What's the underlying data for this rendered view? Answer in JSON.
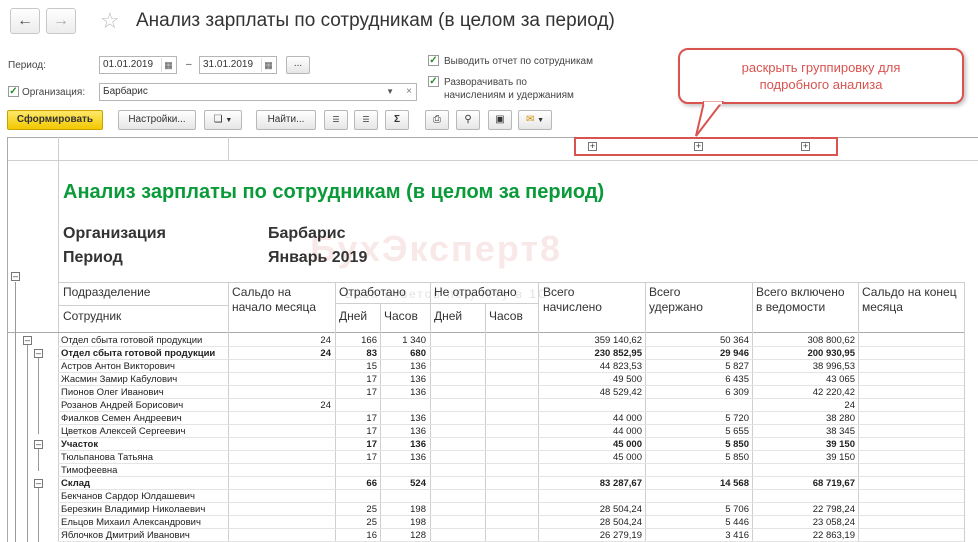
{
  "window": {
    "title": "Анализ зарплаты по сотрудникам (в целом за период)"
  },
  "form": {
    "period_label": "Период:",
    "date_from": "01.01.2019",
    "dash": "–",
    "date_to": "31.01.2019",
    "dots": "...",
    "org_label": "Организация:",
    "org_value": "Барбарис",
    "opt1": "Выводить отчет по сотрудникам",
    "opt2_line1": "Разворачивать по",
    "opt2_line2": "начислениям и удержаниям"
  },
  "toolbar": {
    "generate": "Сформировать",
    "settings": "Настройки...",
    "find": "Найти...",
    "sum": "Σ"
  },
  "callout": {
    "line1": "раскрыть группировку для",
    "line2": "подробного анализа"
  },
  "report": {
    "title": "Анализ зарплаты по сотрудникам (в целом за период)",
    "org_caption": "Организация",
    "org_value": "Барбарис",
    "period_caption": "Период",
    "period_value": "Январь 2019",
    "watermark": "БухЭксперт8",
    "watermark_sub": "База ответов по учёту в 1С"
  },
  "columns": {
    "dept": "Подразделение",
    "emp": "Сотрудник",
    "saldo_start": "Сальдо на начало месяца",
    "worked": "Отработано",
    "not_worked": "Не отработано",
    "days": "Дней",
    "hours": "Часов",
    "accrued": "Всего начислено",
    "withheld": "Всего удержано",
    "in_statement": "Всего включено в ведомости",
    "saldo_end": "Сальдо на конец месяца"
  },
  "rows": [
    {
      "name": "Отдел сбыта готовой продукции",
      "saldo": "24",
      "days": "166",
      "hours": "1 340",
      "accrued": "359 140,62",
      "withheld": "50 364",
      "statement": "308 800,62",
      "bold": false,
      "level": 0
    },
    {
      "name": "Отдел сбыта готовой продукции",
      "saldo": "24",
      "days": "83",
      "hours": "680",
      "accrued": "230 852,95",
      "withheld": "29 946",
      "statement": "200 930,95",
      "bold": true,
      "level": 1
    },
    {
      "name": "Астров Антон Викторович",
      "saldo": "",
      "days": "15",
      "hours": "136",
      "accrued": "44 823,53",
      "withheld": "5 827",
      "statement": "38 996,53",
      "bold": false,
      "level": 2
    },
    {
      "name": "Жасмин Замир Кабулович",
      "saldo": "",
      "days": "17",
      "hours": "136",
      "accrued": "49 500",
      "withheld": "6 435",
      "statement": "43 065",
      "bold": false,
      "level": 2
    },
    {
      "name": "Пионов Олег Иванович",
      "saldo": "",
      "days": "17",
      "hours": "136",
      "accrued": "48 529,42",
      "withheld": "6 309",
      "statement": "42 220,42",
      "bold": false,
      "level": 2
    },
    {
      "name": "Розанов Андрей Борисович",
      "saldo": "24",
      "days": "",
      "hours": "",
      "accrued": "",
      "withheld": "",
      "statement": "24",
      "bold": false,
      "level": 2
    },
    {
      "name": "Фиалков Семен Андреевич",
      "saldo": "",
      "days": "17",
      "hours": "136",
      "accrued": "44 000",
      "withheld": "5 720",
      "statement": "38 280",
      "bold": false,
      "level": 2
    },
    {
      "name": "Цветков Алексей Сергеевич",
      "saldo": "",
      "days": "17",
      "hours": "136",
      "accrued": "44 000",
      "withheld": "5 655",
      "statement": "38 345",
      "bold": false,
      "level": 2
    },
    {
      "name": "Участок",
      "saldo": "",
      "days": "17",
      "hours": "136",
      "accrued": "45 000",
      "withheld": "5 850",
      "statement": "39 150",
      "bold": true,
      "level": 1
    },
    {
      "name": "Тюльпанова Татьяна",
      "saldo": "",
      "days": "17",
      "hours": "136",
      "accrued": "45 000",
      "withheld": "5 850",
      "statement": "39 150",
      "bold": false,
      "level": 2
    },
    {
      "name": "Тимофеевна",
      "saldo": "",
      "days": "",
      "hours": "",
      "accrued": "",
      "withheld": "",
      "statement": "",
      "bold": false,
      "level": 2
    },
    {
      "name": "Склад",
      "saldo": "",
      "days": "66",
      "hours": "524",
      "accrued": "83 287,67",
      "withheld": "14 568",
      "statement": "68 719,67",
      "bold": true,
      "level": 1
    },
    {
      "name": "Бекчанов Сардор Юлдашевич",
      "saldo": "",
      "days": "",
      "hours": "",
      "accrued": "",
      "withheld": "",
      "statement": "",
      "bold": false,
      "level": 2
    },
    {
      "name": "Березкин Владимир Николаевич",
      "saldo": "",
      "days": "25",
      "hours": "198",
      "accrued": "28 504,24",
      "withheld": "5 706",
      "statement": "22 798,24",
      "bold": false,
      "level": 2
    },
    {
      "name": "Ельцов Михаил Александрович",
      "saldo": "",
      "days": "25",
      "hours": "198",
      "accrued": "28 504,24",
      "withheld": "5 446",
      "statement": "23 058,24",
      "bold": false,
      "level": 2
    },
    {
      "name": "Яблочков Дмитрий Иванович",
      "saldo": "",
      "days": "16",
      "hours": "128",
      "accrued": "26 279,19",
      "withheld": "3 416",
      "statement": "22 863,19",
      "bold": false,
      "level": 2
    }
  ]
}
